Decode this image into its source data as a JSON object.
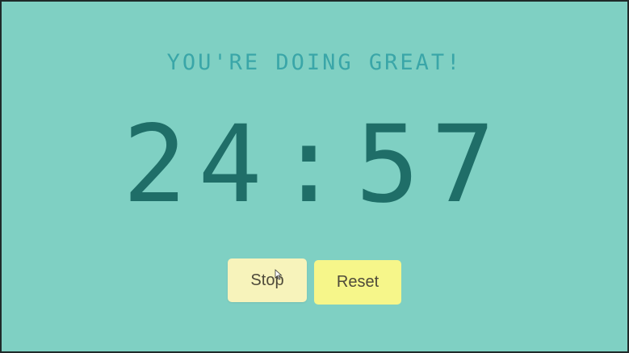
{
  "app": {
    "message": "YOU'RE DOING GREAT!",
    "timer": {
      "minutes": "24",
      "separator": ":",
      "seconds": "57"
    },
    "controls": {
      "stop_label": "Stop",
      "reset_label": "Reset"
    }
  },
  "colors": {
    "background": "#7fd0c3",
    "message": "#3aa6a8",
    "timer": "#1f6e68",
    "stop_button": "#f7f3bb",
    "reset_button": "#f6f68a",
    "button_text": "#4e4a3a"
  },
  "icons": {
    "cursor": "pointer-cursor-icon"
  }
}
